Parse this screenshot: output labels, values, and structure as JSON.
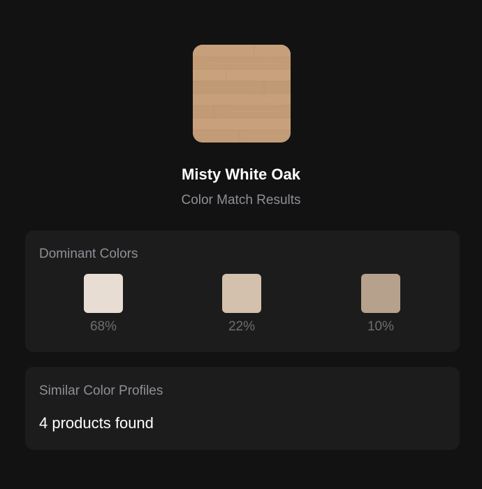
{
  "product": {
    "name": "Misty White Oak",
    "subtitle": "Color Match Results",
    "image_icon": "wood-texture-thumbnail"
  },
  "dominant_colors": {
    "title": "Dominant Colors",
    "swatches": [
      {
        "color": "#e7ddd3",
        "percent": "68%"
      },
      {
        "color": "#d3c0ad",
        "percent": "22%"
      },
      {
        "color": "#b6a18c",
        "percent": "10%"
      }
    ]
  },
  "similar_profiles": {
    "title": "Similar Color Profiles",
    "count_text": "4 products found"
  },
  "colors": {
    "background": "#121212",
    "card": "#1c1c1c",
    "muted_text": "#8f8f97",
    "wood_base": "#c49d78"
  }
}
